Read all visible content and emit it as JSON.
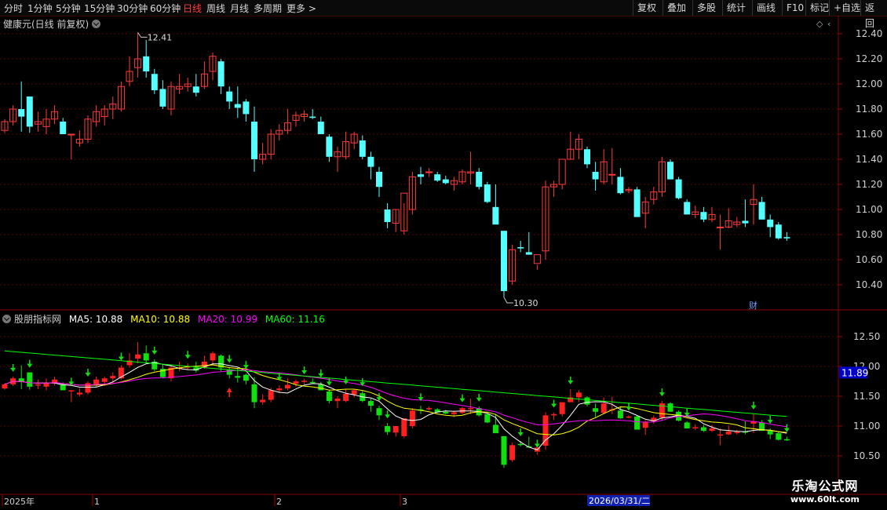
{
  "toolbar": {
    "periods": [
      "分时",
      "1分钟",
      "5分钟",
      "15分钟",
      "30分钟",
      "60分钟",
      "日线",
      "周线",
      "月线",
      "多周期",
      "更多 >"
    ],
    "active_period": "日线",
    "right_buttons": [
      "复权",
      "叠加",
      "多股",
      "统计",
      "画线",
      "F10",
      "标记",
      "+自选",
      "返回"
    ]
  },
  "main_panel": {
    "title": "健康元(日线 前复权)",
    "y_ticks": [
      "12.40",
      "12.20",
      "12.00",
      "11.80",
      "11.60",
      "11.40",
      "11.20",
      "11.00",
      "10.80",
      "10.60",
      "10.40"
    ],
    "high_label": "12.41",
    "low_label": "10.30",
    "cai_badge": "财"
  },
  "indicator_panel": {
    "name": "股朋指标网",
    "ma5_label": "MA5: 10.88",
    "ma10_label": "MA10: 10.88",
    "ma20_label": "MA20: 10.99",
    "ma60_label": "MA60: 11.16",
    "y_ticks": [
      "12.50",
      "12.00",
      "11.50",
      "11.00",
      "10.50"
    ],
    "current_value": "11.89"
  },
  "time_axis": {
    "labels": [
      "2025年",
      "1",
      "2",
      "3"
    ],
    "cursor_date": "2026/03/31/二"
  },
  "watermark": {
    "line1": "乐淘公式网",
    "line2": "www.60lt.com"
  },
  "colors": {
    "up": "#ff3b3b",
    "down": "#54ffff",
    "ma5": "#ffffff",
    "ma10": "#ffff00",
    "ma20": "#ff00ff",
    "ma60": "#00ff00"
  },
  "chart_data": {
    "type": "candlestick",
    "ohlc": [
      [
        11.63,
        11.72,
        11.61,
        11.7
      ],
      [
        11.7,
        11.83,
        11.67,
        11.8
      ],
      [
        11.8,
        12.02,
        11.62,
        11.74
      ],
      [
        11.9,
        11.9,
        11.61,
        11.66
      ],
      [
        11.68,
        11.78,
        11.62,
        11.7
      ],
      [
        11.66,
        11.8,
        11.6,
        11.72
      ],
      [
        11.72,
        11.83,
        11.68,
        11.78
      ],
      [
        11.7,
        11.73,
        11.62,
        11.6
      ],
      [
        11.6,
        11.6,
        11.4,
        11.6
      ],
      [
        11.53,
        11.63,
        11.5,
        11.56
      ],
      [
        11.56,
        11.75,
        11.53,
        11.72
      ],
      [
        11.7,
        11.83,
        11.66,
        11.78
      ],
      [
        11.74,
        11.83,
        11.67,
        11.8
      ],
      [
        11.8,
        11.9,
        11.72,
        11.84
      ],
      [
        11.8,
        12.02,
        11.78,
        11.98
      ],
      [
        12.02,
        12.22,
        11.98,
        12.1
      ],
      [
        12.13,
        12.41,
        12.05,
        12.2
      ],
      [
        12.22,
        12.35,
        12.05,
        12.1
      ],
      [
        12.08,
        12.12,
        11.92,
        11.95
      ],
      [
        11.96,
        12.03,
        11.8,
        11.82
      ],
      [
        11.8,
        12.02,
        11.75,
        11.98
      ],
      [
        11.96,
        12.08,
        11.92,
        11.98
      ],
      [
        11.98,
        12.05,
        11.94,
        12.0
      ],
      [
        11.98,
        12.08,
        11.9,
        11.93
      ],
      [
        11.98,
        12.18,
        11.96,
        12.08
      ],
      [
        12.1,
        12.25,
        12.03,
        12.22
      ],
      [
        12.18,
        12.2,
        11.92,
        11.98
      ],
      [
        11.94,
        11.98,
        11.8,
        11.86
      ],
      [
        11.84,
        11.98,
        11.73,
        11.81
      ],
      [
        11.86,
        11.88,
        11.7,
        11.76
      ],
      [
        11.7,
        11.82,
        11.3,
        11.4
      ],
      [
        11.4,
        11.53,
        11.36,
        11.44
      ],
      [
        11.44,
        11.64,
        11.4,
        11.6
      ],
      [
        11.6,
        11.68,
        11.55,
        11.63
      ],
      [
        11.63,
        11.8,
        11.6,
        11.69
      ],
      [
        11.71,
        11.78,
        11.66,
        11.75
      ],
      [
        11.74,
        11.79,
        11.7,
        11.76
      ],
      [
        11.74,
        11.8,
        11.72,
        11.73
      ],
      [
        11.7,
        11.74,
        11.6,
        11.6
      ],
      [
        11.58,
        11.6,
        11.38,
        11.42
      ],
      [
        11.42,
        11.5,
        11.3,
        11.46
      ],
      [
        11.42,
        11.62,
        11.4,
        11.54
      ],
      [
        11.53,
        11.62,
        11.48,
        11.6
      ],
      [
        11.55,
        11.59,
        11.4,
        11.42
      ],
      [
        11.42,
        11.46,
        11.24,
        11.34
      ],
      [
        11.3,
        11.34,
        11.1,
        11.18
      ],
      [
        11.0,
        11.05,
        10.85,
        10.9
      ],
      [
        10.89,
        11.0,
        10.82,
        11.0
      ],
      [
        10.83,
        11.05,
        10.8,
        11.13
      ],
      [
        11.0,
        11.3,
        10.96,
        11.26
      ],
      [
        11.28,
        11.34,
        11.2,
        11.26
      ],
      [
        11.3,
        11.33,
        11.26,
        11.3
      ],
      [
        11.28,
        11.3,
        11.22,
        11.23
      ],
      [
        11.24,
        11.27,
        11.2,
        11.21
      ],
      [
        11.2,
        11.26,
        11.15,
        11.23
      ],
      [
        11.22,
        11.32,
        11.2,
        11.3
      ],
      [
        11.29,
        11.46,
        11.2,
        11.3
      ],
      [
        11.3,
        11.33,
        11.16,
        11.18
      ],
      [
        11.2,
        11.22,
        11.05,
        11.06
      ],
      [
        11.02,
        11.2,
        10.92,
        10.88
      ],
      [
        10.83,
        10.83,
        10.3,
        10.35
      ],
      [
        10.43,
        10.72,
        10.4,
        10.68
      ],
      [
        10.7,
        10.75,
        10.66,
        10.69
      ],
      [
        10.66,
        10.82,
        10.64,
        10.64
      ],
      [
        10.57,
        10.56,
        10.52,
        10.64
      ],
      [
        10.67,
        11.23,
        10.6,
        11.18
      ],
      [
        11.18,
        11.23,
        11.1,
        11.2
      ],
      [
        11.2,
        11.2,
        11.16,
        11.4
      ],
      [
        11.4,
        11.62,
        11.4,
        11.48
      ],
      [
        11.48,
        11.6,
        11.4,
        11.56
      ],
      [
        11.48,
        11.5,
        11.33,
        11.36
      ],
      [
        11.3,
        11.38,
        11.15,
        11.24
      ],
      [
        11.22,
        11.48,
        11.2,
        11.38
      ],
      [
        11.28,
        11.49,
        11.2,
        11.28
      ],
      [
        11.26,
        11.33,
        11.12,
        11.13
      ],
      [
        11.15,
        11.18,
        11.13,
        11.16
      ],
      [
        11.16,
        11.18,
        10.96,
        10.94
      ],
      [
        10.97,
        11.1,
        10.85,
        11.06
      ],
      [
        11.08,
        11.18,
        11.04,
        11.14
      ],
      [
        11.14,
        11.42,
        11.1,
        11.38
      ],
      [
        11.38,
        11.4,
        11.24,
        11.24
      ],
      [
        11.24,
        11.26,
        11.08,
        11.09
      ],
      [
        11.06,
        11.08,
        10.96,
        10.96
      ],
      [
        10.96,
        11.03,
        10.93,
        10.98
      ],
      [
        10.98,
        11.02,
        10.9,
        10.92
      ],
      [
        10.92,
        11.02,
        10.9,
        10.96
      ],
      [
        10.86,
        10.96,
        10.68,
        10.86
      ],
      [
        10.86,
        11.01,
        10.85,
        10.91
      ],
      [
        10.88,
        10.94,
        10.86,
        10.9
      ],
      [
        10.91,
        11.08,
        10.86,
        10.89
      ],
      [
        11.04,
        11.2,
        10.88,
        11.08
      ],
      [
        11.06,
        11.1,
        10.92,
        10.92
      ],
      [
        10.92,
        10.96,
        10.78,
        10.86
      ],
      [
        10.88,
        10.9,
        10.76,
        10.77
      ],
      [
        10.78,
        10.82,
        10.75,
        10.77
      ]
    ]
  }
}
